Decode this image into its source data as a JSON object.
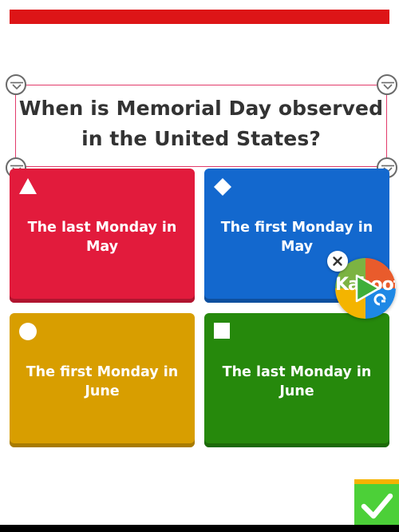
{
  "header": {
    "progress_percent": 100,
    "progress_color": "#dd1517"
  },
  "question": {
    "line1": "When is Memorial Day observed",
    "line2": "in the United States?"
  },
  "answers": [
    {
      "label_line1": "The last Monday in",
      "label_line2": "May",
      "color": "#e21b3c",
      "shape": "triangle-icon"
    },
    {
      "label_line1": "The first Monday in",
      "label_line2": "May",
      "color": "#1368ce",
      "shape": "diamond-icon"
    },
    {
      "label_line1": "The first Monday in",
      "label_line2": "June",
      "color": "#d89e00",
      "shape": "circle-icon"
    },
    {
      "label_line1": "The last Monday in",
      "label_line2": "June",
      "color": "#26890c",
      "shape": "square-icon"
    }
  ],
  "overlay": {
    "logo_text": "Kahoot!",
    "close_icon": "close-icon",
    "play_icon": "play-icon"
  },
  "done_button": {
    "icon": "checkmark-icon",
    "color": "#4cd038"
  }
}
